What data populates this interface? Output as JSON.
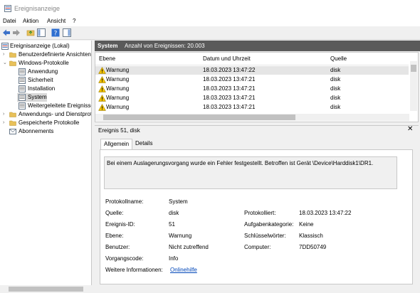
{
  "window": {
    "title": "Ereignisanzeige",
    "icon": "event-viewer-icon"
  },
  "menu": [
    "Datei",
    "Aktion",
    "Ansicht",
    "?"
  ],
  "toolbar": {
    "icons": [
      "back-arrow-icon",
      "forward-arrow-icon",
      "folder-up-icon",
      "console-tree-icon",
      "help-icon",
      "action-pane-icon"
    ]
  },
  "tree": {
    "items": [
      {
        "label": "Ereignisanzeige (Lokal)",
        "icon": "event-viewer-icon",
        "expanded": true
      },
      {
        "label": "Benutzerdefinierte Ansichten",
        "icon": "folder-icon",
        "expanded": false
      },
      {
        "label": "Windows-Protokolle",
        "icon": "folder-icon",
        "expanded": true
      },
      {
        "label": "Anwendung",
        "icon": "log-icon"
      },
      {
        "label": "Sicherheit",
        "icon": "log-icon"
      },
      {
        "label": "Installation",
        "icon": "log-icon"
      },
      {
        "label": "System",
        "icon": "log-icon",
        "selected": true
      },
      {
        "label": "Weitergeleitete Ereignisse",
        "icon": "log-icon"
      },
      {
        "label": "Anwendungs- und Dienstprotokolle",
        "icon": "folder-icon",
        "expanded": false
      },
      {
        "label": "Gespeicherte Protokolle",
        "icon": "folder-icon",
        "expanded": false
      },
      {
        "label": "Abonnements",
        "icon": "subscription-icon"
      }
    ]
  },
  "list_header": {
    "log_name": "System",
    "count_text": "Anzahl von Ereignissen: 20.003"
  },
  "columns": [
    "Ebene",
    "Datum und Uhrzeit",
    "Quelle"
  ],
  "rows": [
    {
      "level": "Warnung",
      "datetime": "18.03.2023 13:47:22",
      "source": "disk",
      "selected": true
    },
    {
      "level": "Warnung",
      "datetime": "18.03.2023 13:47:21",
      "source": "disk"
    },
    {
      "level": "Warnung",
      "datetime": "18.03.2023 13:47:21",
      "source": "disk"
    },
    {
      "level": "Warnung",
      "datetime": "18.03.2023 13:47:21",
      "source": "disk"
    },
    {
      "level": "Warnung",
      "datetime": "18.03.2023 13:47:21",
      "source": "disk"
    }
  ],
  "detail": {
    "title": "Ereignis 51, disk",
    "tabs": [
      "Allgemein",
      "Details"
    ],
    "description": "Bei einem Auslagerungsvorgang wurde ein Fehler festgestellt. Betroffen ist Gerät \\Device\\Harddisk1\\DR1.",
    "props_left": [
      {
        "label": "Protokollname:",
        "value": "System"
      },
      {
        "label": "Quelle:",
        "value": "disk"
      },
      {
        "label": "Ereignis-ID:",
        "value": "51"
      },
      {
        "label": "Ebene:",
        "value": "Warnung"
      },
      {
        "label": "Benutzer:",
        "value": "Nicht zutreffend"
      },
      {
        "label": "Vorgangscode:",
        "value": "Info"
      },
      {
        "label": "Weitere Informationen:",
        "value": "Onlinehilfe"
      }
    ],
    "props_right": [
      {
        "label": "Protokolliert:",
        "value": "18.03.2023 13:47:22"
      },
      {
        "label": "Aufgabenkategorie:",
        "value": "Keine"
      },
      {
        "label": "Schlüsselwörter:",
        "value": "Klassisch"
      },
      {
        "label": "Computer:",
        "value": "7DD50749"
      }
    ]
  },
  "colors": {
    "header_bar": "#5a5a5a",
    "link": "#0046b8",
    "warning": "#f2c200"
  }
}
